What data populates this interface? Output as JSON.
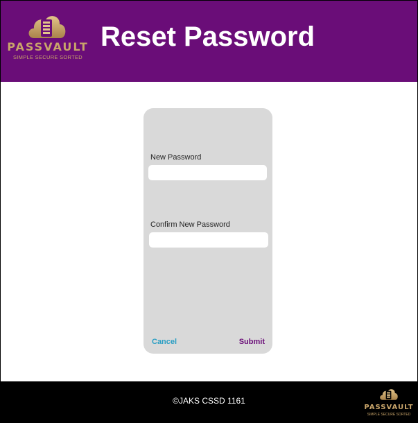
{
  "header": {
    "brand_name": "PASSVAULT",
    "brand_tagline": "SIMPLE SECURE SORTED",
    "title": "Reset Password"
  },
  "form": {
    "new_password_label": "New Password",
    "new_password_value": "",
    "confirm_password_label": "Confirm New Password",
    "confirm_password_value": "",
    "cancel_label": "Cancel",
    "submit_label": "Submit"
  },
  "footer": {
    "copyright": "©JAKS CSSD 1161",
    "brand_name": "PASSVAULT",
    "brand_tagline": "SIMPLE SECURE SORTED"
  },
  "colors": {
    "header_bg": "#6a0d78",
    "card_bg": "#d9d9d9",
    "cancel": "#2b9fc4",
    "submit": "#6a0d78",
    "gold": "#c9a56a",
    "footer_bg": "#000000"
  },
  "icons": {
    "logo": "cloud-server-icon"
  }
}
